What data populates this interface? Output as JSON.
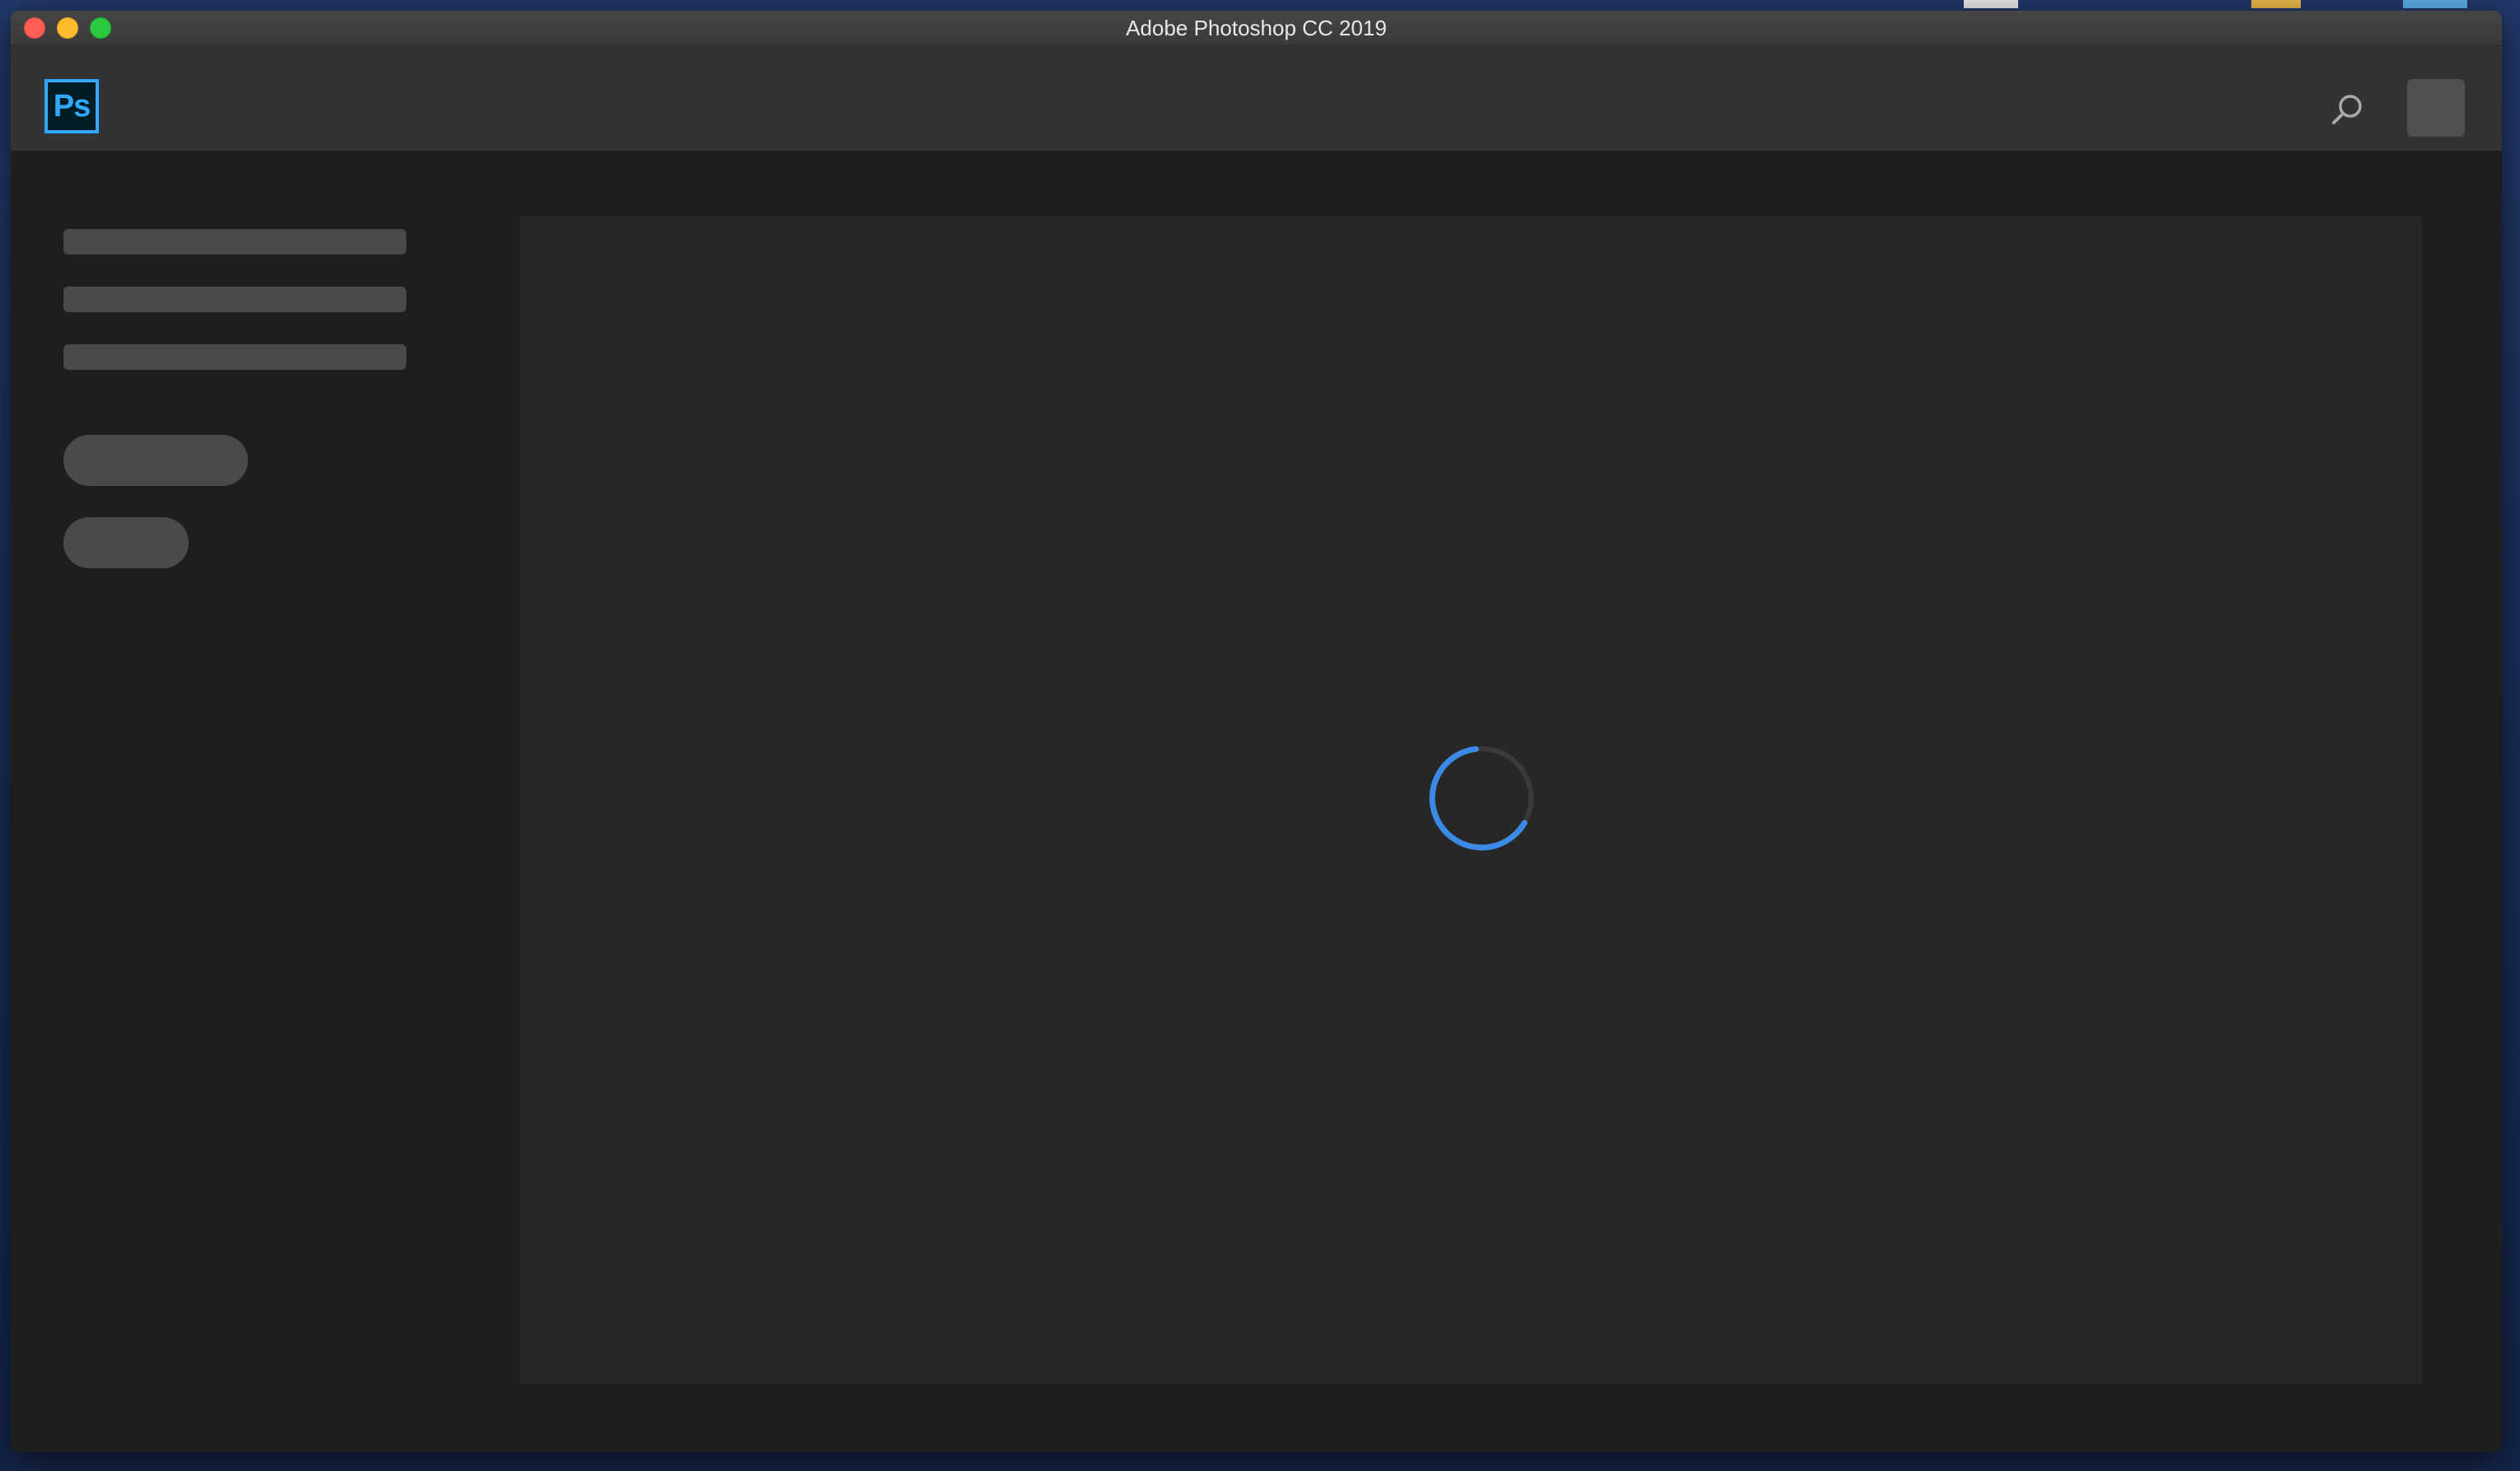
{
  "window": {
    "title": "Adobe Photoshop CC 2019"
  },
  "app": {
    "logo_text": "Ps",
    "accent_color": "#31a8ff"
  },
  "toolbar": {
    "search_icon": "search-icon",
    "avatar": "avatar-placeholder"
  },
  "main": {
    "status": "loading"
  },
  "colors": {
    "spinner": "#3b8ae6",
    "close": "#fe5f57",
    "minimize": "#febb2e",
    "maximize": "#2bc840"
  }
}
